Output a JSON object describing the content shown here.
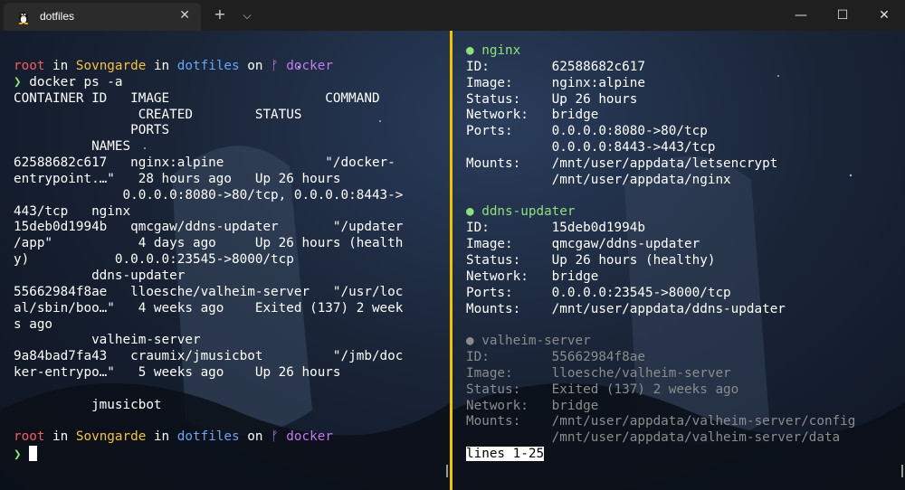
{
  "tab": {
    "title": "dotfiles",
    "icon": "linux-tux-icon",
    "close": "✕"
  },
  "titlebar": {
    "new_tab": "+",
    "dropdown": "⌵",
    "minimize": "—",
    "maximize": "☐",
    "close": "✕"
  },
  "colors": {
    "accent_divider": "#f2c200",
    "prompt_user": "#f25d63",
    "prompt_host": "#f5c340",
    "prompt_dir": "#6aa5f5",
    "prompt_branch": "#c57af0",
    "healthy_dot": "#8ee07d"
  },
  "left": {
    "prompt1": {
      "user": "root",
      "in1": " in ",
      "host": "Sovngarde",
      "in2": " in ",
      "dir": "dotfiles",
      "on": " on ",
      "branch_icon": "ᚠ",
      "branch": " docker"
    },
    "command_arrow": "❯",
    "command": " docker ps -a",
    "output": [
      "CONTAINER ID   IMAGE                    COMMAND",
      "                CREATED        STATUS",
      "               PORTS",
      "          NAMES",
      "62588682c617   nginx:alpine             \"/docker-",
      "entrypoint.…\"   28 hours ago   Up 26 hours",
      "              0.0.0.0:8080->80/tcp, 0.0.0.0:8443->",
      "443/tcp   nginx",
      "15deb0d1994b   qmcgaw/ddns-updater       \"/updater",
      "/app\"           4 days ago     Up 26 hours (health",
      "y)           0.0.0.0:23545->8000/tcp",
      "          ddns-updater",
      "55662984f8ae   lloesche/valheim-server   \"/usr/loc",
      "al/sbin/boo…\"   4 weeks ago    Exited (137) 2 week",
      "s ago",
      "          valheim-server",
      "9a84bad7fa43   craumix/jmusicbot         \"/jmb/doc",
      "ker-entrypo…\"   5 weeks ago    Up 26 hours",
      "",
      "          jmusicbot",
      ""
    ],
    "prompt2": {
      "user": "root",
      "in1": " in ",
      "host": "Sovngarde",
      "in2": " in ",
      "dir": "dotfiles",
      "on": " on ",
      "branch_icon": "ᚠ",
      "branch": " docker"
    },
    "prompt2_arrow": "❯ "
  },
  "right": {
    "containers": [
      {
        "dot": "●",
        "name": " nginx",
        "state": "running",
        "rows": [
          "ID:        62588682c617",
          "Image:     nginx:alpine",
          "Status:    Up 26 hours",
          "Network:   bridge",
          "Ports:     0.0.0.0:8080->80/tcp",
          "           0.0.0.0:8443->443/tcp",
          "Mounts:    /mnt/user/appdata/letsencrypt",
          "           /mnt/user/appdata/nginx"
        ]
      },
      {
        "dot": "●",
        "name": " ddns-updater",
        "state": "running",
        "rows": [
          "ID:        15deb0d1994b",
          "Image:     qmcgaw/ddns-updater",
          "Status:    Up 26 hours (healthy)",
          "Network:   bridge",
          "Ports:     0.0.0.0:23545->8000/tcp",
          "Mounts:    /mnt/user/appdata/ddns-updater"
        ]
      },
      {
        "dot": "●",
        "name": " valheim-server",
        "state": "exited",
        "rows": [
          "ID:        55662984f8ae",
          "Image:     lloesche/valheim-server",
          "Status:    Exited (137) 2 weeks ago",
          "Network:   bridge",
          "Mounts:    /mnt/user/appdata/valheim-server/config",
          "           /mnt/user/appdata/valheim-server/data"
        ]
      }
    ],
    "pager_status": "lines 1-25"
  }
}
